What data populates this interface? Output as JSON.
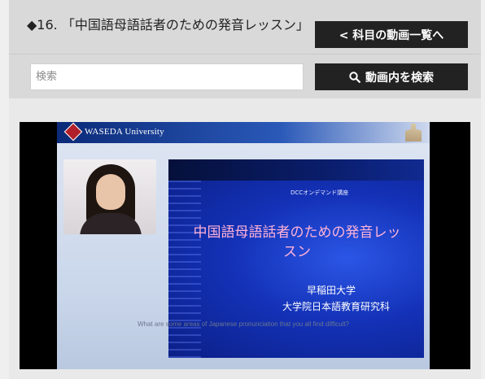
{
  "header": {
    "title": "◆16. 「中国語母語話者のための発音レッスン」",
    "back_button_label": "< 科目の動画一覧へ"
  },
  "search": {
    "placeholder": "検索",
    "button_label": "動画内を検索",
    "icon": "search-icon"
  },
  "video": {
    "university_header": "WASEDA University",
    "course_tag": "DCCオンデマンド講座",
    "lesson_title": "中国語母語話者のための発音レッスン",
    "university_name": "早稲田大学",
    "department": "大学院日本語教育研究科",
    "caption": "What are some areas of Japanese pronunciation that you all find difficult?"
  },
  "colors": {
    "button_bg": "#222222",
    "header_bg": "#d9d9d9",
    "accent_red": "#b1202a"
  }
}
